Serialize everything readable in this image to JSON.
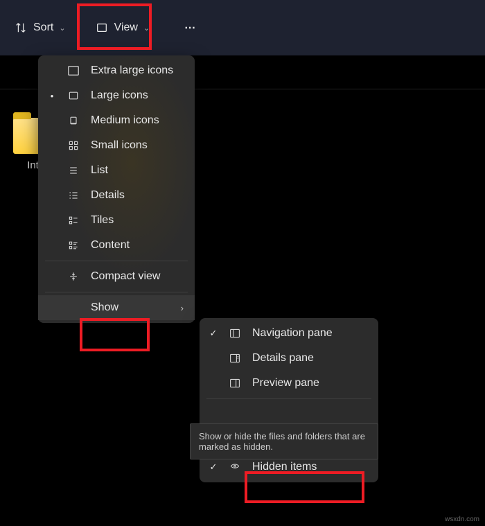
{
  "toolbar": {
    "sort_label": "Sort",
    "view_label": "View",
    "more_label": "⋯"
  },
  "folder": {
    "name": "Intr"
  },
  "view_menu": {
    "items": [
      {
        "label": "Extra large icons",
        "icon": "rect-xl",
        "checked": false
      },
      {
        "label": "Large icons",
        "icon": "rect-l",
        "checked": true
      },
      {
        "label": "Medium icons",
        "icon": "rect-m",
        "checked": false
      },
      {
        "label": "Small icons",
        "icon": "grid-s",
        "checked": false
      },
      {
        "label": "List",
        "icon": "list-compact",
        "checked": false
      },
      {
        "label": "Details",
        "icon": "list-details",
        "checked": false
      },
      {
        "label": "Tiles",
        "icon": "tiles",
        "checked": false
      },
      {
        "label": "Content",
        "icon": "content",
        "checked": false
      }
    ],
    "compact_label": "Compact view",
    "show_label": "Show"
  },
  "show_menu": {
    "items": [
      {
        "label": "Navigation pane",
        "icon": "pane-nav",
        "checked": true
      },
      {
        "label": "Details pane",
        "icon": "pane-details",
        "checked": false
      },
      {
        "label": "Preview pane",
        "icon": "pane-preview",
        "checked": false
      }
    ],
    "hidden_label": "Hidden items",
    "hidden_checked": true
  },
  "tooltip_text": "Show or hide the files and folders that are marked as hidden.",
  "watermark": "wsxdn.com"
}
